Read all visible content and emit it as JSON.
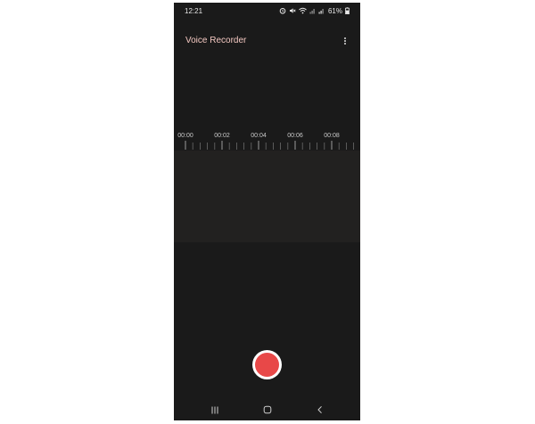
{
  "status_bar": {
    "time": "12:21",
    "battery": "61%",
    "icons": [
      "alarm-icon",
      "mute-icon",
      "wifi-icon",
      "signal-icon",
      "signal-icon",
      "battery-icon"
    ]
  },
  "app": {
    "title": "Voice Recorder",
    "more_icon": "more-vert-icon"
  },
  "timeline": {
    "labels": [
      "00:00",
      "00:02",
      "00:04",
      "00:06",
      "00:08"
    ]
  },
  "recorder": {
    "record_icon": "record-icon",
    "record_color": "#e84848"
  },
  "nav": {
    "items": [
      "recent-apps-icon",
      "home-icon",
      "back-icon"
    ]
  }
}
